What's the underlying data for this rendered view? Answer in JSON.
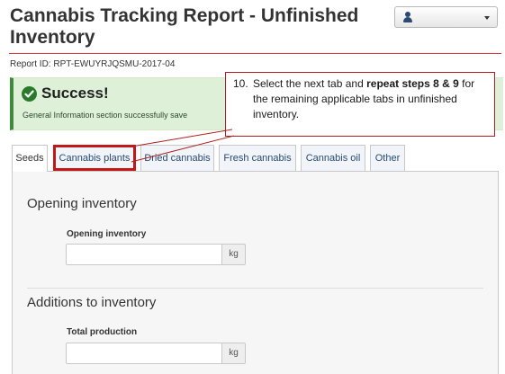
{
  "header": {
    "title": "Cannabis Tracking Report - Unfinished Inventory",
    "report_id": "Report ID: RPT-EWUYRJQSMU-2017-04",
    "user_menu_icon": "user-icon"
  },
  "alert": {
    "heading": "Success!",
    "message": "General Information section successfully save",
    "icon": "check-circle-icon",
    "color": "#dff0d8"
  },
  "callout": {
    "number": "10.",
    "text_before": "Select the next tab and ",
    "text_bold": "repeat steps 8 & 9",
    "text_after": " for the remaining applicable tabs in unfinished inventory.",
    "border_color": "#b02020"
  },
  "tabs": [
    {
      "label": "Seeds",
      "active": true
    },
    {
      "label": "Cannabis plants",
      "highlighted": true
    },
    {
      "label": "Dried cannabis"
    },
    {
      "label": "Fresh cannabis"
    },
    {
      "label": "Cannabis oil"
    },
    {
      "label": "Other"
    }
  ],
  "sections": {
    "opening": {
      "heading": "Opening inventory",
      "field_label": "Opening inventory",
      "value": "",
      "unit": "kg"
    },
    "additions": {
      "heading": "Additions to inventory",
      "field_label": "Total production",
      "value": "",
      "unit": "kg"
    }
  }
}
